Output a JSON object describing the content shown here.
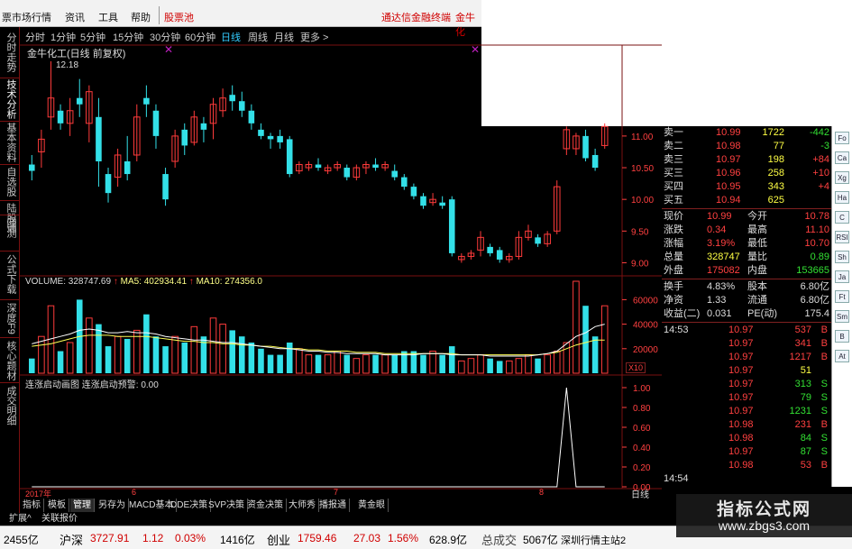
{
  "menu": {
    "items": [
      "票市场行情",
      "资讯",
      "工具",
      "帮助",
      "股票池"
    ],
    "right_items": [
      "通达信金融终端",
      "金牛化"
    ]
  },
  "left_tabs": [
    "分时走势",
    "技术分析",
    "基本资料",
    "自选股",
    "陆股通",
    "回测",
    "公式下载",
    "深度F9",
    "核心题材",
    "成交明细"
  ],
  "periods": [
    "分时",
    "1分钟",
    "5分钟",
    "15分钟",
    "30分钟",
    "60分钟",
    "日线",
    "周线",
    "月线",
    "更多 >"
  ],
  "active_period": "日线",
  "chart_title": "金牛化工(日线 前复权)",
  "high_label": "12.18",
  "volume_line": {
    "vol": "VOLUME: 328747.69",
    "ma5": "MA5: 402934.41",
    "ma10": "MA10: 274356.0"
  },
  "indicator_line": "连涨启动画图  连涨启动预警: 0.00",
  "x10_label": "X10",
  "day_label": "日线",
  "date_labels": [
    "2017年",
    "6",
    "7",
    "8"
  ],
  "colors": {
    "up": "#ff3b3b",
    "down": "#33e0e8",
    "grid": "#7a1010",
    "ma5": "#ffffff",
    "ma10": "#ffff55",
    "bg": "#000000"
  },
  "chart_data": {
    "type": "candlestick",
    "price_axis": [
      "11.00",
      "10.50",
      "10.00",
      "9.50",
      "9.00"
    ],
    "volume_axis": [
      "60000",
      "40000",
      "20000"
    ],
    "indicator_axis": [
      "1.00",
      "0.80",
      "0.60",
      "0.40",
      "0.20",
      "0.00"
    ],
    "candles": [
      {
        "o": 10.55,
        "c": 10.45,
        "h": 10.7,
        "l": 10.3
      },
      {
        "o": 10.75,
        "c": 10.95,
        "h": 11.1,
        "l": 10.5
      },
      {
        "o": 11.3,
        "c": 11.6,
        "h": 12.18,
        "l": 11.1
      },
      {
        "o": 11.4,
        "c": 11.2,
        "h": 11.5,
        "l": 11.1
      },
      {
        "o": 11.2,
        "c": 11.4,
        "h": 11.6,
        "l": 11.0
      },
      {
        "o": 11.6,
        "c": 11.5,
        "h": 11.9,
        "l": 11.3
      },
      {
        "o": 11.2,
        "c": 11.7,
        "h": 11.8,
        "l": 10.9
      },
      {
        "o": 11.3,
        "c": 10.6,
        "h": 11.6,
        "l": 10.2
      },
      {
        "o": 10.4,
        "c": 10.1,
        "h": 10.5,
        "l": 9.95
      },
      {
        "o": 10.35,
        "c": 10.7,
        "h": 10.8,
        "l": 10.2
      },
      {
        "o": 10.6,
        "c": 10.4,
        "h": 11.0,
        "l": 10.3
      },
      {
        "o": 10.7,
        "c": 11.3,
        "h": 11.5,
        "l": 10.6
      },
      {
        "o": 11.6,
        "c": 11.5,
        "h": 11.8,
        "l": 11.3
      },
      {
        "o": 11.4,
        "c": 11.0,
        "h": 11.5,
        "l": 10.8
      },
      {
        "o": 10.4,
        "c": 10.0,
        "h": 10.5,
        "l": 9.9
      },
      {
        "o": 10.6,
        "c": 11.0,
        "h": 11.1,
        "l": 10.5
      },
      {
        "o": 11.1,
        "c": 10.85,
        "h": 11.2,
        "l": 10.7
      },
      {
        "o": 10.9,
        "c": 11.3,
        "h": 11.4,
        "l": 10.85
      },
      {
        "o": 11.2,
        "c": 11.1,
        "h": 11.3,
        "l": 10.9
      },
      {
        "o": 11.2,
        "c": 11.5,
        "h": 11.6,
        "l": 10.95
      },
      {
        "o": 11.4,
        "c": 11.6,
        "h": 11.75,
        "l": 11.3
      },
      {
        "o": 11.65,
        "c": 11.55,
        "h": 11.8,
        "l": 11.4
      },
      {
        "o": 11.55,
        "c": 11.4,
        "h": 11.7,
        "l": 11.3
      },
      {
        "o": 11.4,
        "c": 11.2,
        "h": 11.5,
        "l": 11.1
      },
      {
        "o": 11.1,
        "c": 11.0,
        "h": 11.2,
        "l": 10.95
      },
      {
        "o": 11.0,
        "c": 10.95,
        "h": 11.05,
        "l": 10.8
      },
      {
        "o": 11.0,
        "c": 10.9,
        "h": 11.1,
        "l": 10.8
      },
      {
        "o": 10.95,
        "c": 10.4,
        "h": 11.0,
        "l": 10.35
      },
      {
        "o": 10.45,
        "c": 10.55,
        "h": 10.6,
        "l": 10.4
      },
      {
        "o": 10.5,
        "c": 10.55,
        "h": 10.6,
        "l": 10.45
      },
      {
        "o": 10.55,
        "c": 10.5,
        "h": 10.65,
        "l": 10.45
      },
      {
        "o": 10.45,
        "c": 10.5,
        "h": 10.55,
        "l": 10.4
      },
      {
        "o": 10.5,
        "c": 10.55,
        "h": 10.6,
        "l": 10.45
      },
      {
        "o": 10.5,
        "c": 10.35,
        "h": 10.55,
        "l": 10.3
      },
      {
        "o": 10.35,
        "c": 10.5,
        "h": 10.55,
        "l": 10.3
      },
      {
        "o": 10.5,
        "c": 10.55,
        "h": 10.6,
        "l": 10.4
      },
      {
        "o": 10.55,
        "c": 10.5,
        "h": 10.65,
        "l": 10.45
      },
      {
        "o": 10.5,
        "c": 10.55,
        "h": 10.6,
        "l": 10.45
      },
      {
        "o": 10.45,
        "c": 10.35,
        "h": 10.55,
        "l": 10.3
      },
      {
        "o": 10.35,
        "c": 10.2,
        "h": 10.4,
        "l": 10.15
      },
      {
        "o": 10.2,
        "c": 10.05,
        "h": 10.25,
        "l": 10.0
      },
      {
        "o": 10.05,
        "c": 9.9,
        "h": 10.1,
        "l": 9.85
      },
      {
        "o": 9.95,
        "c": 10.0,
        "h": 10.1,
        "l": 9.9
      },
      {
        "o": 9.95,
        "c": 9.9,
        "h": 10.05,
        "l": 9.85
      },
      {
        "o": 10.0,
        "c": 9.15,
        "h": 10.05,
        "l": 9.1
      },
      {
        "o": 9.05,
        "c": 9.1,
        "h": 9.15,
        "l": 9.0
      },
      {
        "o": 9.1,
        "c": 9.15,
        "h": 9.2,
        "l": 9.05
      },
      {
        "o": 9.2,
        "c": 9.4,
        "h": 9.5,
        "l": 9.1
      },
      {
        "o": 9.25,
        "c": 9.15,
        "h": 9.3,
        "l": 9.1
      },
      {
        "o": 9.2,
        "c": 9.05,
        "h": 9.25,
        "l": 9.0
      },
      {
        "o": 9.05,
        "c": 9.1,
        "h": 9.15,
        "l": 9.0
      },
      {
        "o": 9.1,
        "c": 9.4,
        "h": 9.5,
        "l": 9.05
      },
      {
        "o": 9.4,
        "c": 9.5,
        "h": 9.6,
        "l": 9.35
      },
      {
        "o": 9.4,
        "c": 9.3,
        "h": 9.45,
        "l": 9.25
      },
      {
        "o": 9.3,
        "c": 9.45,
        "h": 9.5,
        "l": 9.25
      },
      {
        "o": 9.5,
        "c": 10.2,
        "h": 10.3,
        "l": 9.45
      },
      {
        "o": 10.8,
        "c": 11.1,
        "h": 11.15,
        "l": 10.7
      },
      {
        "o": 10.8,
        "c": 11.0,
        "h": 11.05,
        "l": 10.7
      },
      {
        "o": 11.0,
        "c": 10.65,
        "h": 11.1,
        "l": 10.6
      },
      {
        "o": 10.7,
        "c": 10.5,
        "h": 10.8,
        "l": 10.45
      },
      {
        "o": 10.85,
        "c": 11.15,
        "h": 11.2,
        "l": 10.8
      }
    ],
    "volumes": [
      12,
      30,
      55,
      18,
      25,
      60,
      45,
      40,
      22,
      30,
      28,
      35,
      48,
      30,
      22,
      30,
      25,
      38,
      30,
      45,
      40,
      35,
      30,
      25,
      20,
      15,
      15,
      25,
      20,
      15,
      15,
      15,
      18,
      15,
      12,
      15,
      15,
      15,
      15,
      18,
      18,
      15,
      18,
      15,
      22,
      10,
      12,
      15,
      12,
      10,
      10,
      12,
      15,
      12,
      15,
      18,
      25,
      75,
      55,
      30,
      55
    ],
    "ma5": [
      24,
      26,
      28,
      30,
      32,
      35,
      36,
      35,
      33,
      33,
      34,
      33,
      33,
      32,
      30,
      29,
      28,
      27,
      27,
      26,
      25,
      25,
      24,
      23,
      22,
      21,
      20,
      20,
      19,
      18,
      18,
      17,
      17,
      16,
      16,
      16,
      16,
      15,
      15,
      15,
      15,
      16,
      16,
      16,
      15,
      15,
      15,
      15,
      14,
      14,
      14,
      14,
      14,
      15,
      16,
      18,
      24,
      30,
      33,
      38,
      40
    ],
    "ma10": [
      22,
      23,
      24,
      26,
      28,
      30,
      31,
      31,
      31,
      30,
      30,
      30,
      30,
      29,
      28,
      27,
      26,
      26,
      25,
      25,
      24,
      24,
      23,
      23,
      22,
      22,
      21,
      20,
      20,
      19,
      19,
      18,
      18,
      18,
      17,
      17,
      17,
      16,
      16,
      16,
      16,
      16,
      16,
      16,
      16,
      15,
      15,
      15,
      15,
      15,
      15,
      15,
      15,
      15,
      16,
      17,
      20,
      23,
      25,
      27,
      27
    ],
    "indicator": [
      0,
      0,
      0,
      0,
      0,
      0,
      0,
      0,
      0,
      0,
      0,
      0,
      0,
      0,
      0,
      0,
      0,
      0,
      0,
      0,
      0,
      0,
      0,
      0,
      0,
      0,
      0,
      0,
      0,
      0,
      0,
      0,
      0,
      0,
      0,
      0,
      0,
      0,
      0,
      0,
      0,
      0,
      0,
      0,
      0,
      0,
      0,
      0,
      0,
      0,
      0,
      0,
      0,
      0,
      0,
      0,
      1,
      0,
      0,
      0,
      0
    ]
  },
  "quote": {
    "asks": [
      {
        "label": "卖一",
        "price": "10.99",
        "vol": "1722",
        "chg": "-442"
      },
      {
        "label": "卖二",
        "price": "10.98",
        "vol": "77",
        "chg": "-3"
      },
      {
        "label": "卖三",
        "price": "10.97",
        "vol": "198",
        "chg": "+84"
      },
      {
        "label": "买三",
        "price": "10.96",
        "vol": "258",
        "chg": "+10"
      },
      {
        "label": "买四",
        "price": "10.95",
        "vol": "343",
        "chg": "+4"
      },
      {
        "label": "买五",
        "price": "10.94",
        "vol": "625",
        "chg": ""
      }
    ],
    "stats": [
      {
        "l1": "现价",
        "v1": "10.99",
        "l2": "今开",
        "v2": "10.78"
      },
      {
        "l1": "涨跌",
        "v1": "0.34",
        "l2": "最高",
        "v2": "11.10"
      },
      {
        "l1": "涨幅",
        "v1": "3.19%",
        "l2": "最低",
        "v2": "10.70"
      },
      {
        "l1": "总量",
        "v1": "328747",
        "l2": "量比",
        "v2": "0.89"
      },
      {
        "l1": "外盘",
        "v1": "175082",
        "l2": "内盘",
        "v2": "153665"
      },
      {
        "l1": "换手",
        "v1": "4.83%",
        "l2": "股本",
        "v2": "6.80亿"
      },
      {
        "l1": "净资",
        "v1": "1.33",
        "l2": "流通",
        "v2": "6.80亿"
      },
      {
        "l1": "收益(二)",
        "v1": "0.031",
        "l2": "PE(动)",
        "v2": "175.4"
      }
    ],
    "ticks_time1": "14:53",
    "ticks1": [
      {
        "price": "10.97",
        "vol": "537",
        "bs": "B"
      },
      {
        "price": "10.97",
        "vol": "341",
        "bs": "B"
      },
      {
        "price": "10.97",
        "vol": "1217",
        "bs": "B"
      },
      {
        "price": "10.97",
        "vol": "51",
        "bs": ""
      },
      {
        "price": "10.97",
        "vol": "313",
        "bs": "S"
      },
      {
        "price": "10.97",
        "vol": "79",
        "bs": "S"
      },
      {
        "price": "10.97",
        "vol": "1231",
        "bs": "S"
      },
      {
        "price": "10.98",
        "vol": "231",
        "bs": "B"
      },
      {
        "price": "10.98",
        "vol": "84",
        "bs": "S"
      },
      {
        "price": "10.97",
        "vol": "87",
        "bs": "S"
      },
      {
        "price": "10.98",
        "vol": "53",
        "bs": "B"
      }
    ],
    "ticks_time2": "14:54"
  },
  "bottom_tabs": [
    "指标",
    "模板",
    "管理",
    "另存为",
    "MACD基本",
    "DDE决策",
    "SVP决策",
    "资金决策",
    "大师秀",
    "播报通",
    "黄金眼"
  ],
  "tabs2": [
    "扩展^",
    "关联报价"
  ],
  "status": {
    "a": "2455亿",
    "hs_label": "沪深",
    "hs_val": "3727.91",
    "hs_chg": "1.12",
    "hs_pct": "0.03%",
    "hs_amt": "1416亿",
    "cy_label": "创业",
    "cy_val": "1759.46",
    "cy_chg": "27.03",
    "cy_pct": "1.56%",
    "cy_amt": "628.9亿",
    "total_label": "总成交",
    "total_val": "5067亿",
    "server": "深圳行情主站2"
  },
  "side_icons": [
    "Fo",
    "Ca",
    "Xg",
    "Ha",
    "C",
    "RSI",
    "Sh",
    "Ja",
    "Ft",
    "Sm",
    "B",
    "At"
  ],
  "watermark": {
    "line1": "指标公式网",
    "line2": "www.zbgs3.com"
  }
}
